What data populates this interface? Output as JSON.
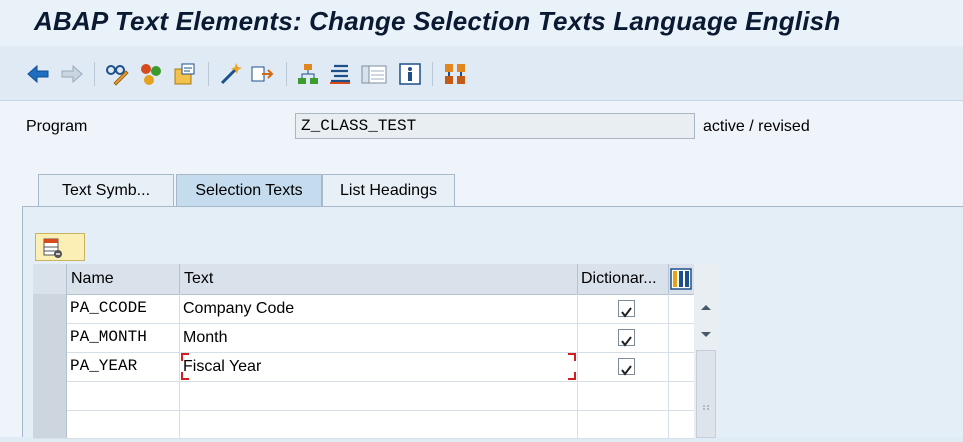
{
  "window": {
    "title": "ABAP Text Elements: Change Selection Texts Language English"
  },
  "toolbar": {
    "icons": [
      "back-icon",
      "forward-icon",
      "display-change-icon",
      "activate-icon",
      "other-object-icon",
      "check-icon",
      "where-used-icon",
      "hierarchy-icon",
      "comparison-icon",
      "layout-icon",
      "info-icon",
      "transport-icon"
    ]
  },
  "header": {
    "program_label": "Program",
    "program_value": "Z_CLASS_TEST",
    "status": "active / revised"
  },
  "tabs": [
    {
      "label": "Text Symb...",
      "active": false
    },
    {
      "label": "Selection Texts",
      "active": true
    },
    {
      "label": "List Headings",
      "active": false
    }
  ],
  "table": {
    "columns": [
      "Name",
      "Text",
      "Dictionar..."
    ],
    "rows": [
      {
        "name": "PA_CCODE",
        "text": "Company Code",
        "dictionary": true
      },
      {
        "name": "PA_MONTH",
        "text": "Month",
        "dictionary": true
      },
      {
        "name": "PA_YEAR",
        "text": "Fiscal Year",
        "dictionary": true
      },
      {
        "name": "",
        "text": "",
        "dictionary": false
      },
      {
        "name": "",
        "text": "",
        "dictionary": false
      }
    ]
  },
  "colors": {
    "title": "#0b1a33",
    "cursor": "#d21e1e",
    "active_tab": "#c5dcef"
  }
}
